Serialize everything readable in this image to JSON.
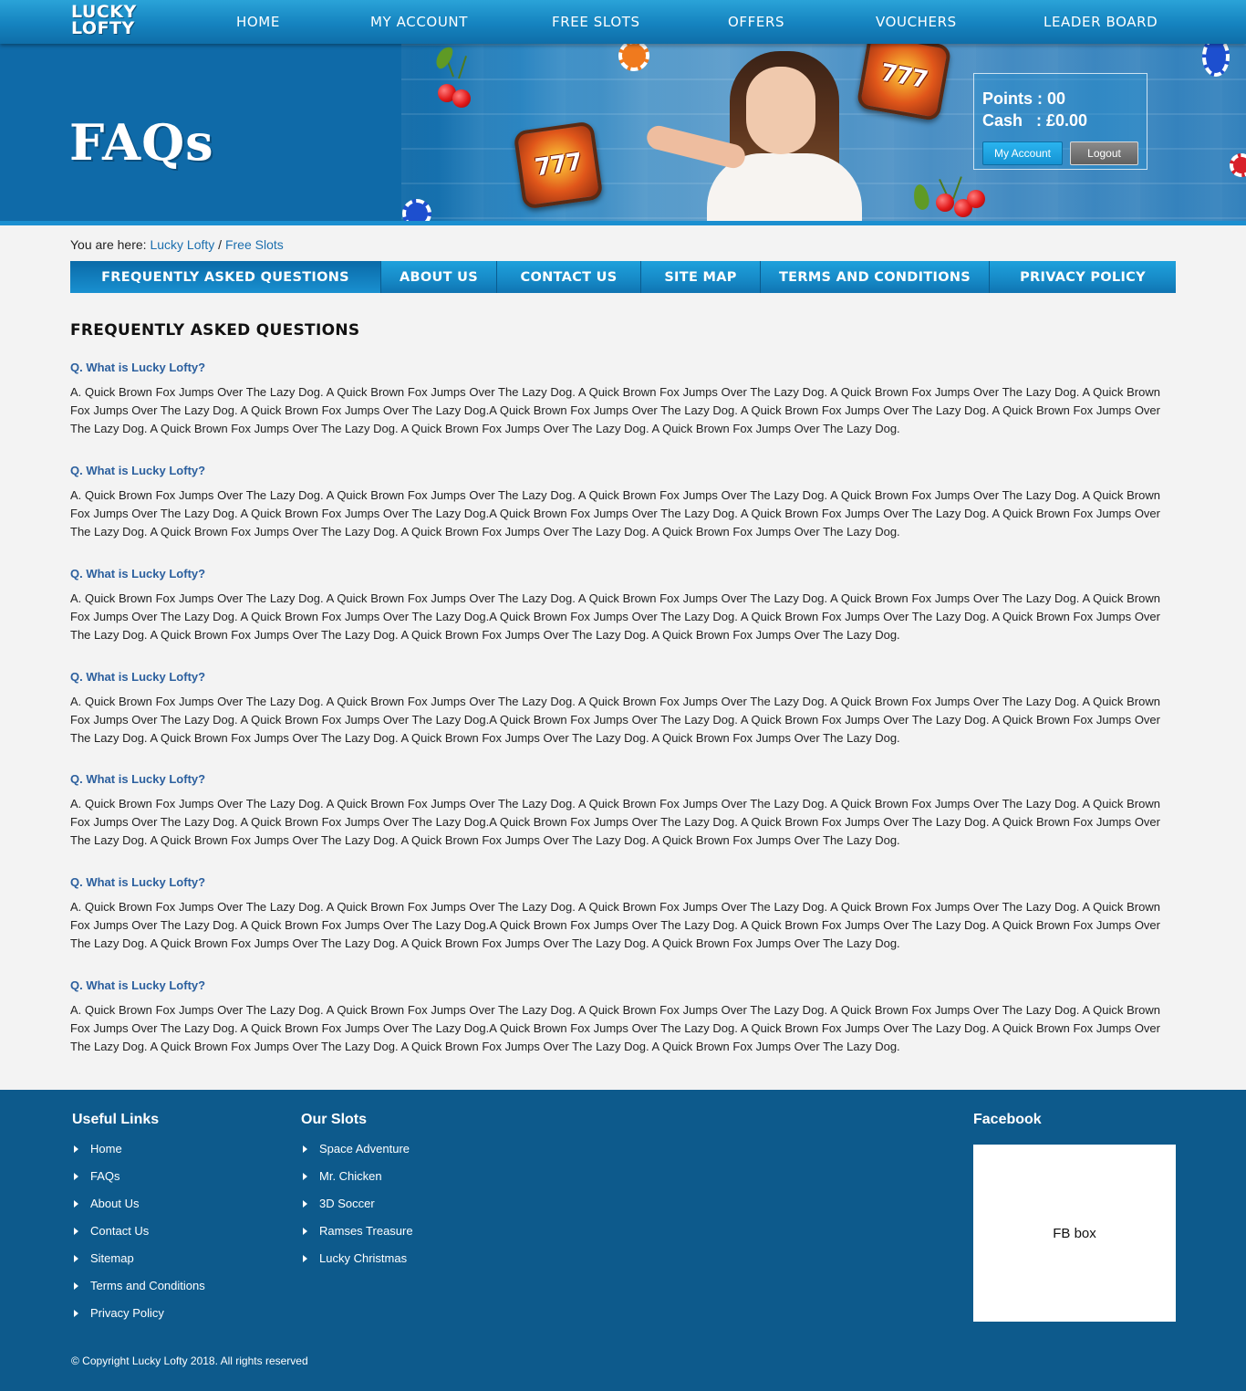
{
  "brand": {
    "line1": "LUCKY",
    "line2": "LOFTY"
  },
  "nav": [
    "HOME",
    "MY ACCOUNT",
    "FREE SLOTS",
    "OFFERS",
    "VOUCHERS",
    "LEADER BOARD"
  ],
  "hero": {
    "title": "FAQs",
    "slot_text": "777"
  },
  "account": {
    "points_line": "Points : 00",
    "cash_line": "Cash   : £0.00",
    "my_account_label": "My Account",
    "logout_label": "Logout"
  },
  "breadcrumb": {
    "prefix": "You are here: ",
    "home": "Lucky Lofty",
    "separator": " / ",
    "current": "Free Slots"
  },
  "tabs": [
    "FREQUENTLY ASKED QUESTIONS",
    "ABOUT US",
    "CONTACT US",
    "SITE MAP",
    "TERMS AND CONDITIONS",
    "PRIVACY POLICY"
  ],
  "faq": {
    "title": "FREQUENTLY ASKED QUESTIONS",
    "items": [
      {
        "q": "Q. What is Lucky Lofty?",
        "a": "A. Quick Brown Fox Jumps Over The Lazy Dog. A Quick Brown Fox Jumps Over The Lazy Dog. A Quick Brown Fox Jumps Over The Lazy Dog. A Quick Brown Fox Jumps Over The Lazy Dog. A Quick Brown Fox Jumps Over The Lazy Dog. A Quick Brown Fox Jumps Over The Lazy Dog.A Quick Brown Fox Jumps Over The Lazy Dog. A Quick Brown Fox Jumps Over The Lazy Dog. A Quick Brown Fox Jumps Over The Lazy Dog. A Quick Brown Fox Jumps Over The Lazy Dog. A Quick Brown Fox Jumps Over The Lazy Dog. A Quick Brown Fox Jumps Over The Lazy Dog."
      },
      {
        "q": "Q. What is Lucky Lofty?",
        "a": "A. Quick Brown Fox Jumps Over The Lazy Dog. A Quick Brown Fox Jumps Over The Lazy Dog. A Quick Brown Fox Jumps Over The Lazy Dog. A Quick Brown Fox Jumps Over The Lazy Dog. A Quick Brown Fox Jumps Over The Lazy Dog. A Quick Brown Fox Jumps Over The Lazy Dog.A Quick Brown Fox Jumps Over The Lazy Dog. A Quick Brown Fox Jumps Over The Lazy Dog. A Quick Brown Fox Jumps Over The Lazy Dog. A Quick Brown Fox Jumps Over The Lazy Dog. A Quick Brown Fox Jumps Over The Lazy Dog. A Quick Brown Fox Jumps Over The Lazy Dog."
      },
      {
        "q": "Q. What is Lucky Lofty?",
        "a": "A. Quick Brown Fox Jumps Over The Lazy Dog. A Quick Brown Fox Jumps Over The Lazy Dog. A Quick Brown Fox Jumps Over The Lazy Dog. A Quick Brown Fox Jumps Over The Lazy Dog. A Quick Brown Fox Jumps Over The Lazy Dog. A Quick Brown Fox Jumps Over The Lazy Dog.A Quick Brown Fox Jumps Over The Lazy Dog. A Quick Brown Fox Jumps Over The Lazy Dog. A Quick Brown Fox Jumps Over The Lazy Dog. A Quick Brown Fox Jumps Over The Lazy Dog. A Quick Brown Fox Jumps Over The Lazy Dog. A Quick Brown Fox Jumps Over The Lazy Dog."
      },
      {
        "q": "Q. What is Lucky Lofty?",
        "a": "A. Quick Brown Fox Jumps Over The Lazy Dog. A Quick Brown Fox Jumps Over The Lazy Dog. A Quick Brown Fox Jumps Over The Lazy Dog. A Quick Brown Fox Jumps Over The Lazy Dog. A Quick Brown Fox Jumps Over The Lazy Dog. A Quick Brown Fox Jumps Over The Lazy Dog.A Quick Brown Fox Jumps Over The Lazy Dog. A Quick Brown Fox Jumps Over The Lazy Dog. A Quick Brown Fox Jumps Over The Lazy Dog. A Quick Brown Fox Jumps Over The Lazy Dog. A Quick Brown Fox Jumps Over The Lazy Dog. A Quick Brown Fox Jumps Over The Lazy Dog."
      },
      {
        "q": "Q. What is Lucky Lofty?",
        "a": "A. Quick Brown Fox Jumps Over The Lazy Dog. A Quick Brown Fox Jumps Over The Lazy Dog. A Quick Brown Fox Jumps Over The Lazy Dog. A Quick Brown Fox Jumps Over The Lazy Dog. A Quick Brown Fox Jumps Over The Lazy Dog. A Quick Brown Fox Jumps Over The Lazy Dog.A Quick Brown Fox Jumps Over The Lazy Dog. A Quick Brown Fox Jumps Over The Lazy Dog. A Quick Brown Fox Jumps Over The Lazy Dog. A Quick Brown Fox Jumps Over The Lazy Dog. A Quick Brown Fox Jumps Over The Lazy Dog. A Quick Brown Fox Jumps Over The Lazy Dog."
      },
      {
        "q": "Q. What is Lucky Lofty?",
        "a": "A. Quick Brown Fox Jumps Over The Lazy Dog. A Quick Brown Fox Jumps Over The Lazy Dog. A Quick Brown Fox Jumps Over The Lazy Dog. A Quick Brown Fox Jumps Over The Lazy Dog. A Quick Brown Fox Jumps Over The Lazy Dog. A Quick Brown Fox Jumps Over The Lazy Dog.A Quick Brown Fox Jumps Over The Lazy Dog. A Quick Brown Fox Jumps Over The Lazy Dog. A Quick Brown Fox Jumps Over The Lazy Dog. A Quick Brown Fox Jumps Over The Lazy Dog. A Quick Brown Fox Jumps Over The Lazy Dog. A Quick Brown Fox Jumps Over The Lazy Dog."
      },
      {
        "q": "Q. What is Lucky Lofty?",
        "a": "A. Quick Brown Fox Jumps Over The Lazy Dog. A Quick Brown Fox Jumps Over The Lazy Dog. A Quick Brown Fox Jumps Over The Lazy Dog. A Quick Brown Fox Jumps Over The Lazy Dog. A Quick Brown Fox Jumps Over The Lazy Dog. A Quick Brown Fox Jumps Over The Lazy Dog.A Quick Brown Fox Jumps Over The Lazy Dog. A Quick Brown Fox Jumps Over The Lazy Dog. A Quick Brown Fox Jumps Over The Lazy Dog. A Quick Brown Fox Jumps Over The Lazy Dog. A Quick Brown Fox Jumps Over The Lazy Dog. A Quick Brown Fox Jumps Over The Lazy Dog."
      }
    ]
  },
  "footer": {
    "useful_title": "Useful Links",
    "useful_links": [
      "Home",
      "FAQs",
      "About Us",
      "Contact Us",
      "Sitemap",
      "Terms and Conditions",
      "Privacy Policy"
    ],
    "slots_title": "Our Slots",
    "slots_links": [
      "Space Adventure",
      "Mr. Chicken",
      "3D Soccer",
      "Ramses Treasure",
      "Lucky Christmas"
    ],
    "facebook_title": "Facebook",
    "fb_placeholder": "FB box",
    "copyright": "© Copyright Lucky Lofty 2018. All rights reserved"
  },
  "colors": {
    "nav_top": "#2aa3d8",
    "nav_bottom": "#0f6ea8",
    "hero_left": "#0f6aa8",
    "link_blue": "#1c6fae",
    "question_blue": "#2b5f9e",
    "footer_bg": "#0d5a8c",
    "page_bg": "#f3f3f3"
  }
}
